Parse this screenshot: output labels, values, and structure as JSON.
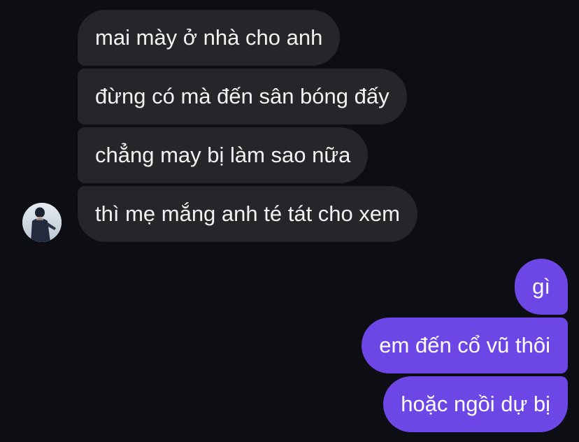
{
  "incoming_messages": [
    {
      "text": "mai mày ở nhà cho anh"
    },
    {
      "text": "đừng có mà đến sân bóng đấy"
    },
    {
      "text": "chẳng may bị làm sao nữa"
    },
    {
      "text": "thì mẹ mắng anh té tát cho xem"
    }
  ],
  "outgoing_messages": [
    {
      "text": "gì"
    },
    {
      "text": "em đến cổ vũ thôi"
    },
    {
      "text": "hoặc ngồi dự bị"
    }
  ],
  "colors": {
    "background": "#0c0e13",
    "incoming_bubble": "#252629",
    "outgoing_bubble": "#6d47e6",
    "incoming_text": "#f2f2f3",
    "outgoing_text": "#ffffff"
  }
}
